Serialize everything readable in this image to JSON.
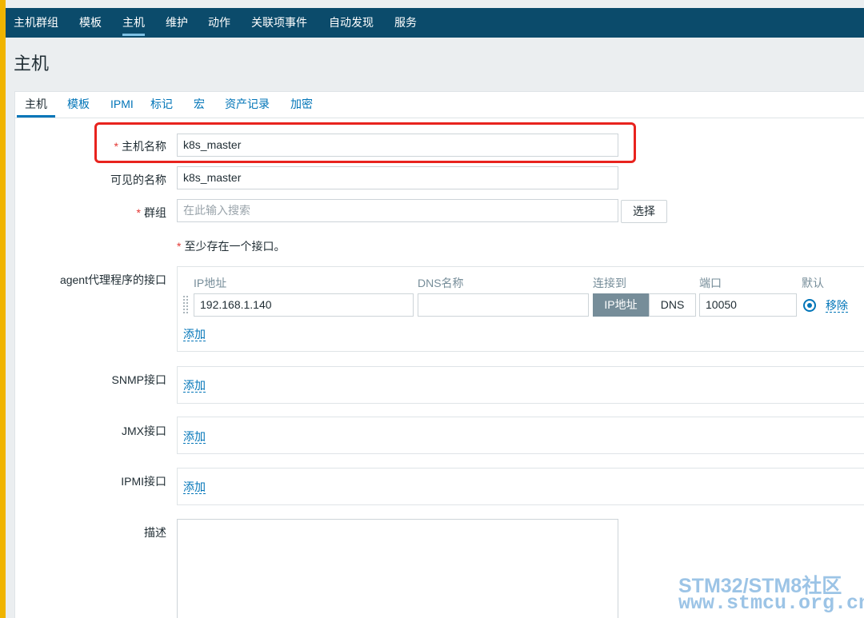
{
  "topnav": {
    "items": [
      "主机群组",
      "模板",
      "主机",
      "维护",
      "动作",
      "关联项事件",
      "自动发现",
      "服务"
    ],
    "active": "主机"
  },
  "page": {
    "title": "主机"
  },
  "tabs": {
    "items": [
      "主机",
      "模板",
      "IPMI",
      "标记",
      "宏",
      "资产记录",
      "加密"
    ],
    "active": "主机"
  },
  "form": {
    "required_mark": "*",
    "host_name": {
      "label": "主机名称",
      "value": "k8s_master"
    },
    "visible_name": {
      "label": "可见的名称",
      "value": "k8s_master"
    },
    "groups": {
      "label": "群组",
      "placeholder": "在此输入搜索",
      "select_button": "选择"
    },
    "interface_note": "至少存在一个接口。",
    "agent": {
      "label": "agent代理程序的接口",
      "headers": {
        "ip": "IP地址",
        "dns": "DNS名称",
        "connect": "连接到",
        "port": "端口",
        "default": "默认"
      },
      "row": {
        "ip": "192.168.1.140",
        "dns": "",
        "connect_ip": "IP地址",
        "connect_dns": "DNS",
        "port": "10050",
        "remove": "移除"
      },
      "add": "添加"
    },
    "snmp": {
      "label": "SNMP接口",
      "add": "添加"
    },
    "jmx": {
      "label": "JMX接口",
      "add": "添加"
    },
    "ipmi": {
      "label": "IPMI接口",
      "add": "添加"
    },
    "description": {
      "label": "描述",
      "value": ""
    }
  },
  "watermark": {
    "line1": "STM32/STM8社区",
    "line2": "www.stmcu.org.cn"
  },
  "colors": {
    "nav_bg": "#0b4b6b",
    "link": "#0275b8",
    "required": "#e33734",
    "highlight": "#e8231e"
  }
}
